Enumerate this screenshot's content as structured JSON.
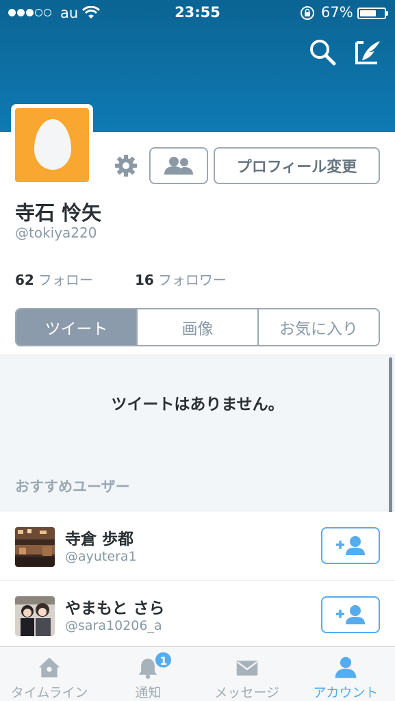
{
  "status_bar": {
    "carrier": "au",
    "time": "23:55",
    "battery_percent": "67%",
    "battery_level": 0.67
  },
  "header": {
    "search_icon": "search-icon",
    "compose_icon": "compose-tweet-icon"
  },
  "profile": {
    "avatar": "default-egg-avatar",
    "settings_icon": "gear-icon",
    "people_icon": "people-icon",
    "edit_profile_label": "プロフィール変更",
    "name": "寺石 怜矢",
    "handle": "@tokiya220",
    "following_count": "62",
    "following_label": "フォロー",
    "followers_count": "16",
    "followers_label": "フォロワー"
  },
  "tabs": [
    {
      "label": "ツイート",
      "selected": true
    },
    {
      "label": "画像",
      "selected": false
    },
    {
      "label": "お気に入り",
      "selected": false
    }
  ],
  "empty_message": "ツイートはありません。",
  "recommended": {
    "title": "おすすめユーザー",
    "users": [
      {
        "name": "寺倉 歩都",
        "handle": "@ayutera1"
      },
      {
        "name": "やまもと さら",
        "handle": "@sara10206_a"
      }
    ]
  },
  "tabbar": {
    "items": [
      {
        "label": "タイムライン",
        "icon": "home-icon"
      },
      {
        "label": "通知",
        "icon": "bell-icon",
        "badge": "1"
      },
      {
        "label": "メッセージ",
        "icon": "envelope-icon"
      },
      {
        "label": "アカウント",
        "icon": "person-icon",
        "active": true
      }
    ]
  },
  "colors": {
    "header": "#0f7ab4",
    "accent": "#55acee",
    "avatar_bg": "#f9a730",
    "selected_tab": "#8b9bab"
  }
}
